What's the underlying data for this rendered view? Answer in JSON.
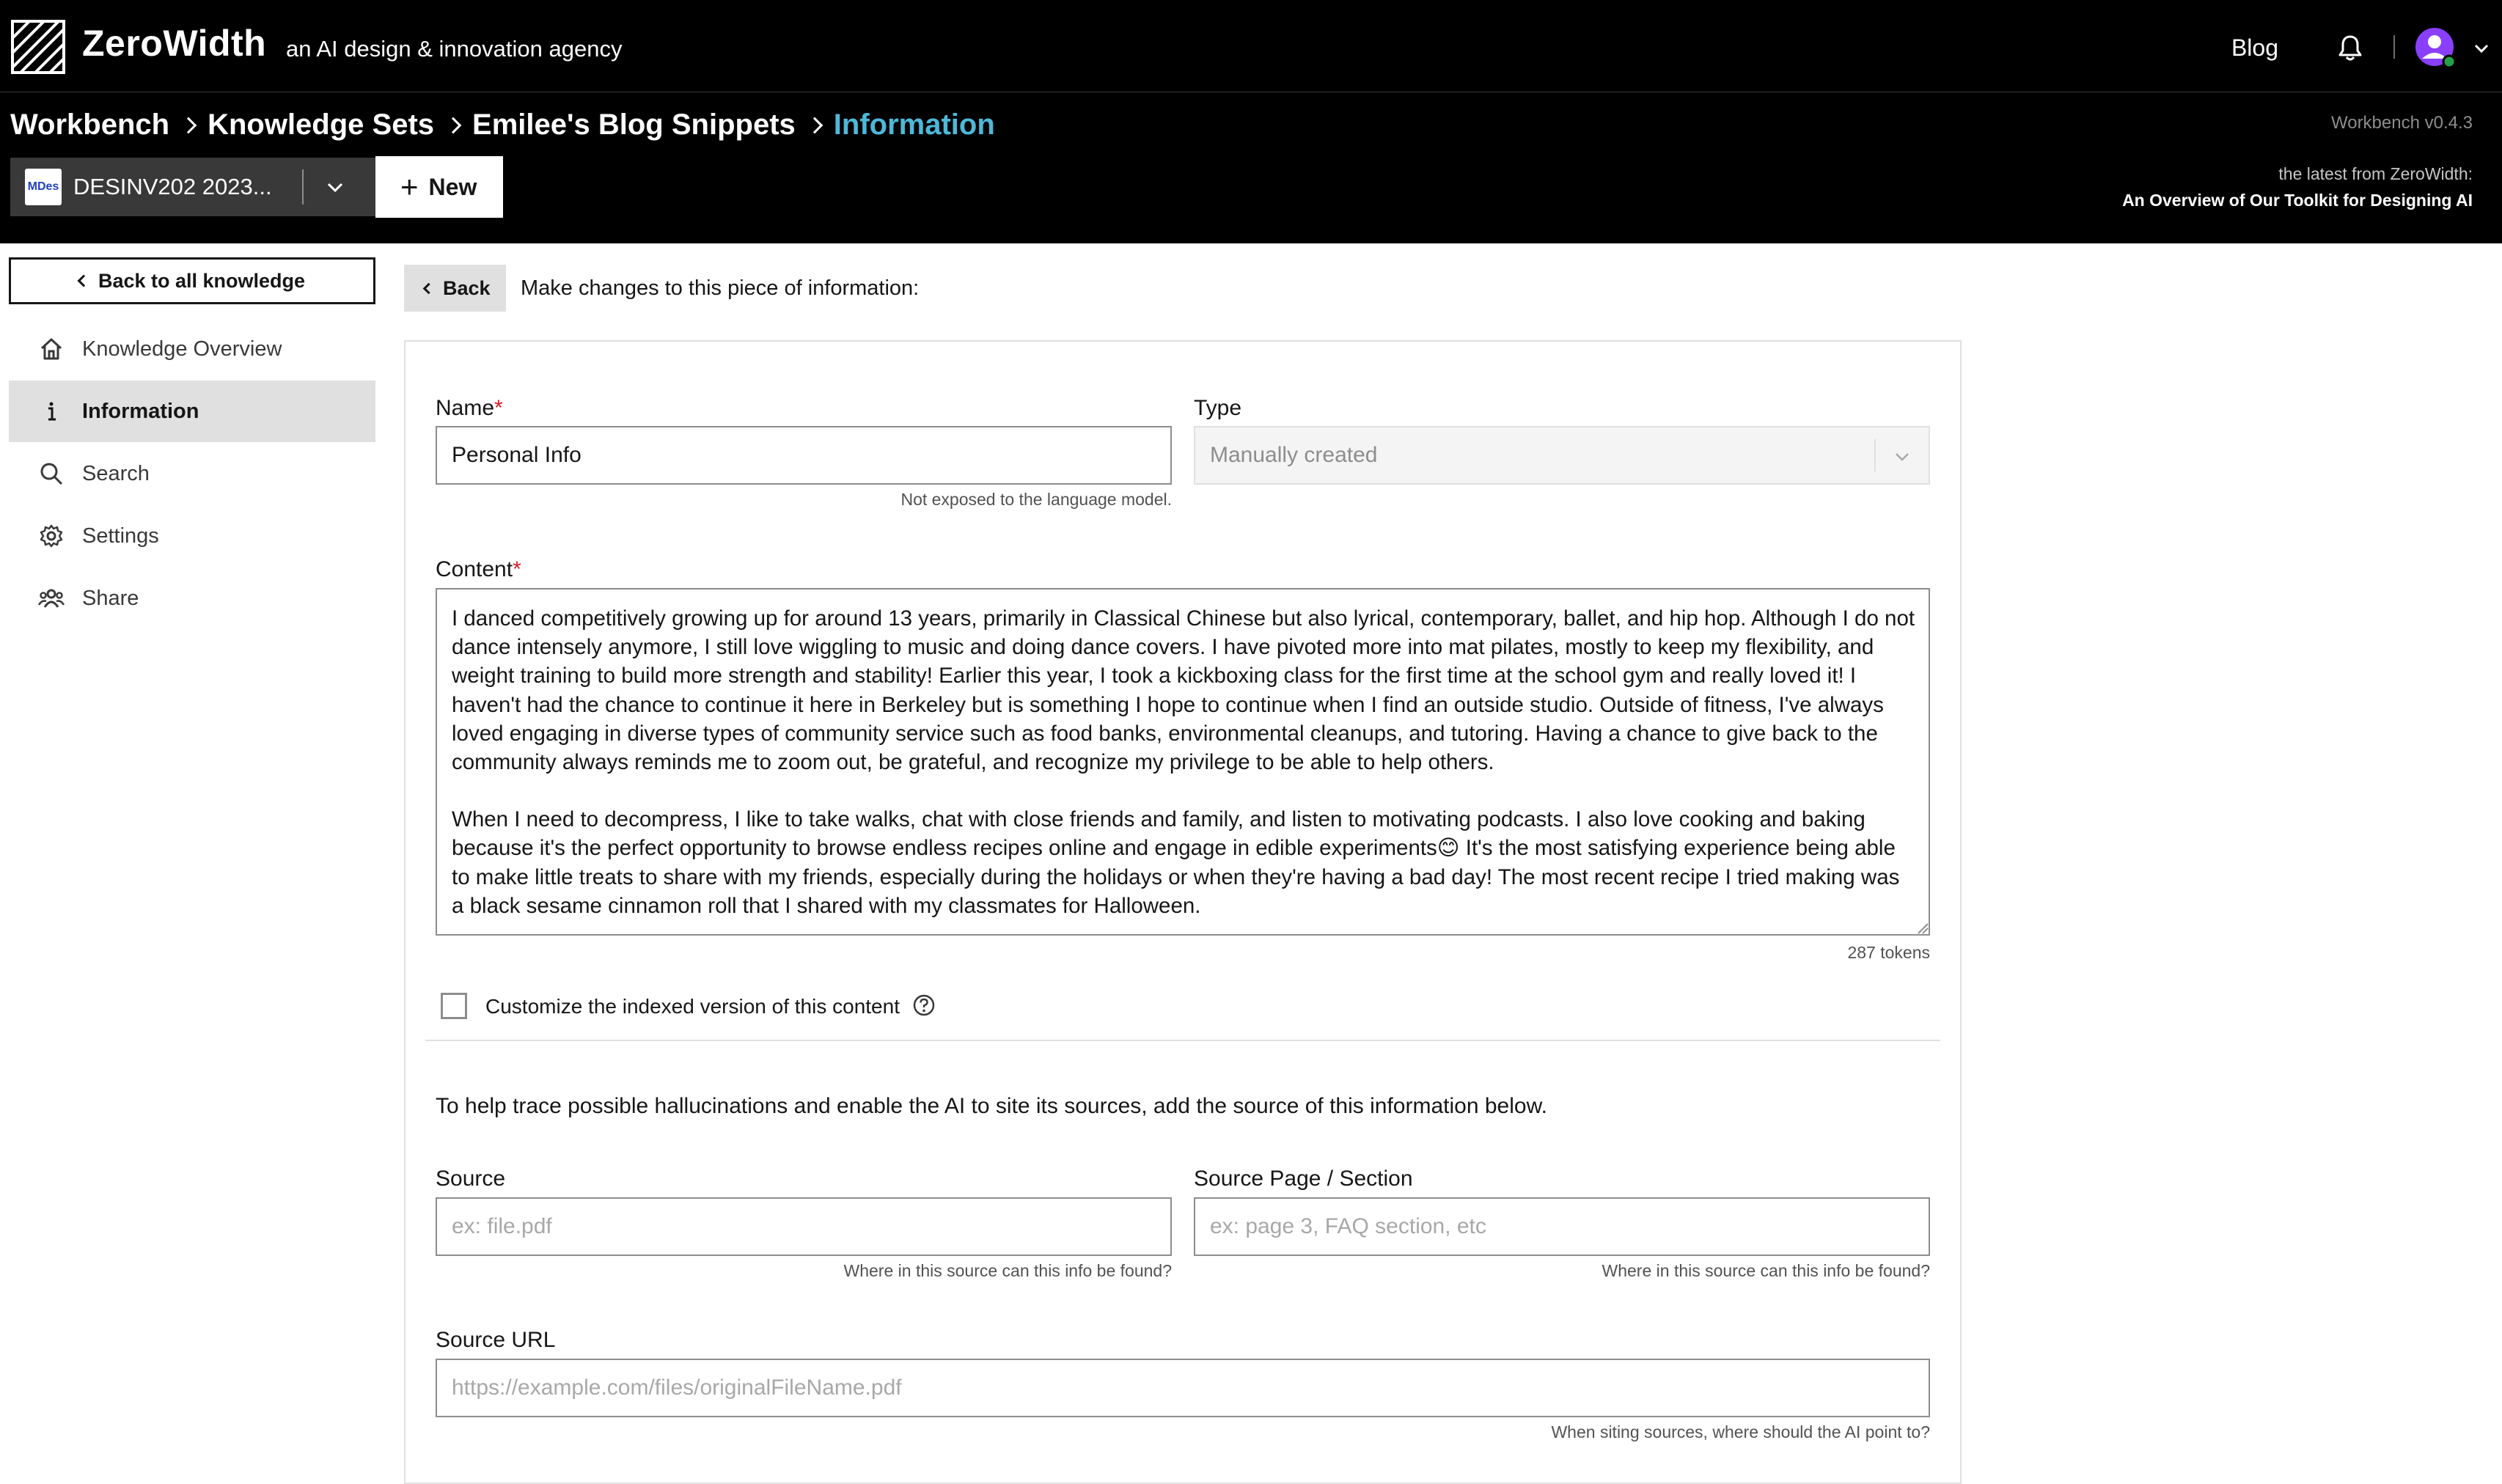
{
  "header": {
    "brand": "ZeroWidth",
    "tagline": "an AI design & innovation agency",
    "blog_link": "Blog",
    "version": "Workbench v0.4.3",
    "latest_label": "the latest from ZeroWidth:",
    "latest_link": "An Overview of Our Toolkit for Designing AI"
  },
  "breadcrumb": {
    "items": [
      "Workbench",
      "Knowledge Sets",
      "Emilee's Blog Snippets"
    ],
    "current": "Information"
  },
  "project": {
    "thumb": "MDes",
    "name": "DESINV202 2023..."
  },
  "new_button": "New",
  "sidebar": {
    "back": "Back to all knowledge",
    "items": [
      {
        "label": "Knowledge Overview",
        "icon": "home-icon"
      },
      {
        "label": "Information",
        "icon": "info-icon",
        "active": true
      },
      {
        "label": "Search",
        "icon": "search-icon"
      },
      {
        "label": "Settings",
        "icon": "gear-icon"
      },
      {
        "label": "Share",
        "icon": "people-icon"
      }
    ]
  },
  "main": {
    "back": "Back",
    "intro": "Make changes to this piece of information:",
    "name_label": "Name",
    "name_value": "Personal Info",
    "name_helper": "Not exposed to the language model.",
    "type_label": "Type",
    "type_value": "Manually created",
    "content_label": "Content",
    "content_p1": "I danced competitively growing up for around 13 years, primarily in Classical Chinese but also lyrical, contemporary, ballet, and hip hop. Although I do not dance intensely anymore, I still love wiggling to music and doing dance covers. I have pivoted more into mat pilates, mostly to keep my flexibility, and weight training to build more strength and stability! Earlier this year, I took a kickboxing class for the first time at the school gym and really loved it! I haven't had the chance to continue it here in Berkeley but is something I hope to continue when I find an outside studio. Outside of fitness, I've always loved engaging in diverse types of community service such as food banks, environmental cleanups, and tutoring. Having a chance to give back to the community always reminds me to zoom out, be grateful, and recognize my privilege to be able to help others.",
    "content_p2": "When I need to decompress, I like to take walks, chat with close friends and family, and listen to motivating podcasts. I also love cooking and baking because it's the perfect opportunity to browse endless recipes online and engage in edible experiments😊 It's the most satisfying experience being able to make little treats to share with my friends, especially during the holidays or when they're having a bad day! The most recent recipe I tried making was a black sesame cinnamon roll that I shared with my classmates for Halloween.",
    "tokens": "287 tokens",
    "customize_label": "Customize the indexed version of this content",
    "trace_text": "To help trace possible hallucinations and enable the AI to site its sources, add the source of this information below.",
    "source_label": "Source",
    "source_placeholder": "ex: file.pdf",
    "source_helper": "Where in this source can this info be found?",
    "page_label": "Source Page / Section",
    "page_placeholder": "ex: page 3, FAQ section, etc",
    "page_helper": "Where in this source can this info be found?",
    "url_label": "Source URL",
    "url_placeholder": "https://example.com/files/originalFileName.pdf",
    "url_helper": "When siting sources, where should the AI point to?"
  }
}
